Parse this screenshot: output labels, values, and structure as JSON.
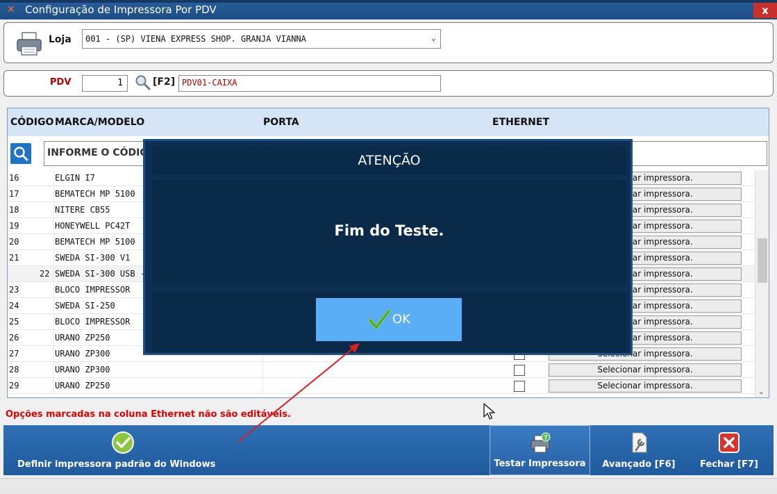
{
  "window": {
    "title": "Configuração de Impressora Por PDV",
    "close_label": "x"
  },
  "loja": {
    "label": "Loja",
    "value": "001 - (SP) VIENA EXPRESS  SHOP. GRANJA VIANNA"
  },
  "pdv": {
    "label": "PDV",
    "number": "1",
    "shortcut": "[F2]",
    "name": "PDV01-CAIXA"
  },
  "grid": {
    "headers": {
      "code": "CÓDIGO",
      "model": "MARCA/MODELO",
      "port": "PORTA",
      "ethernet": "ETHERNET"
    },
    "search_placeholder": "INFORME O CÓDIGO",
    "rows": [
      {
        "code": "16",
        "model": "ELGIN I7",
        "select": "Selecionar impressora."
      },
      {
        "code": "17",
        "model": "BEMATECH MP 5100",
        "select": "Selecionar impressora."
      },
      {
        "code": "18",
        "model": "NITERE CB55",
        "select": "Selecionar impressora."
      },
      {
        "code": "19",
        "model": "HONEYWELL PC42T",
        "select": "Selecionar impressora."
      },
      {
        "code": "20",
        "model": "BEMATECH MP 5100",
        "select": "Selecionar impressora."
      },
      {
        "code": "21",
        "model": "SWEDA SI-300 V1",
        "select": "Selecionar impressora."
      },
      {
        "code": "22",
        "model": "SWEDA SI-300 USB -",
        "select": "Selecionar impressora."
      },
      {
        "code": "23",
        "model": "BLOCO IMPRESSOR",
        "select": "Selecionar impressora."
      },
      {
        "code": "24",
        "model": "SWEDA SI-250",
        "select": "Selecionar impressora."
      },
      {
        "code": "25",
        "model": "BLOCO IMPRESSOR",
        "select": "Selecionar impressora."
      },
      {
        "code": "26",
        "model": "URANO ZP250",
        "select": "Selecionar impressora."
      },
      {
        "code": "27",
        "model": "URANO ZP300",
        "select": "Selecionar impressora."
      },
      {
        "code": "28",
        "model": "URANO ZP300",
        "select": "Selecionar impressora."
      },
      {
        "code": "29",
        "model": "URANO ZP250",
        "select": "Selecionar impressora."
      }
    ]
  },
  "warning": "Opções marcadas na coluna Ethernet não são editáveis.",
  "toolbar": {
    "define_default": "Definir impressora padrão do Windows",
    "test_printer": "Testar Impressora",
    "advanced": "Avançado [F6]",
    "close": "Fechar [F7]"
  },
  "modal": {
    "title": "ATENÇÃO",
    "message": "Fim do Teste.",
    "ok_label": "OK"
  },
  "colors": {
    "titlebar": "#1d4c86",
    "toolbar": "#1f5a9c",
    "modal_bg": "#0a2a4a",
    "ok_button": "#5aaef5",
    "warning": "#e00000"
  }
}
